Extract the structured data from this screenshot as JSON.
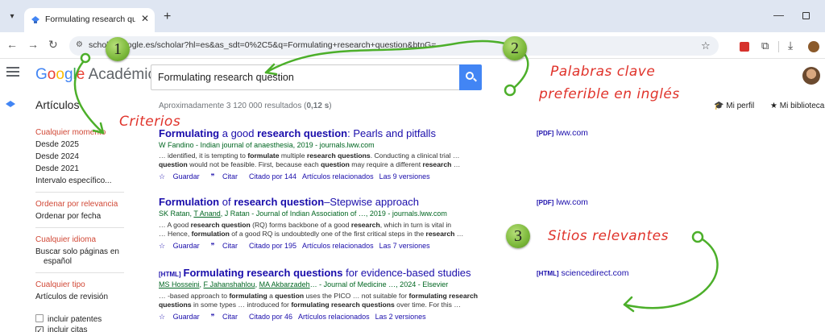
{
  "browser": {
    "tab_title": "Formulating research question",
    "url": "https://scholar.google.es/scholar?hl=es&as_sdt=0%2C5&q=Formulating+research+question&btnG=",
    "url_display": "scholar.google.es/scholar?hl=es&as_sdt=0%2C5&q=Formulating+research+question&btnG="
  },
  "header": {
    "logo_google": "Google",
    "logo_academico": "Académico",
    "search_value": "Formulating research question",
    "articles_label": "Artículos",
    "result_count_prefix": "Aproximadamente 3 120 000 resultados (",
    "result_time": "0,12 s",
    "result_count_suffix": ")",
    "my_profile": "Mi perfil",
    "my_library": "Mi biblioteca"
  },
  "sidebar": {
    "time": [
      "Cualquier momento",
      "Desde 2025",
      "Desde 2024",
      "Desde 2021",
      "Intervalo específico..."
    ],
    "sort": [
      "Ordenar por relevancia",
      "Ordenar por fecha"
    ],
    "lang": [
      "Cualquier idioma",
      "Buscar solo páginas en",
      "español"
    ],
    "type": [
      "Cualquier tipo",
      "Artículos de revisión"
    ],
    "checks": [
      "incluir patentes",
      "incluir citas"
    ]
  },
  "results": [
    {
      "tag": "",
      "title_parts": [
        "Formulating",
        " a good ",
        "research question",
        ": Pearls and pitfalls"
      ],
      "meta": "W Fandino - Indian journal of anaesthesia, 2019 - journals.lww.com",
      "snippet1": "… identified, it is tempting to formulate multiple research questions. Conducting a clinical trial …",
      "snippet2": "question would not be feasible. First, because each question may require a different research …",
      "cite_count": "Citado por 144",
      "versions": "Las 9 versiones",
      "side_tag": "[PDF]",
      "side_site": "lww.com"
    },
    {
      "tag": "",
      "title_parts": [
        "Formulation",
        " of ",
        "research question",
        "–Stepwise approach"
      ],
      "meta": "SK Ratan, T Anand, J Ratan - Journal of Indian Association of …, 2019 - journals.lww.com",
      "snippet1": "… A good research question (RQ) forms backbone of a good research, which in turn is vital in",
      "snippet2": "… Hence, formulation of a good RQ is undoubtedly one of the first critical steps in the research …",
      "cite_count": "Citado por 195",
      "versions": "Las 7 versiones",
      "side_tag": "[PDF]",
      "side_site": "lww.com"
    },
    {
      "tag": "[HTML]",
      "title_parts": [
        "Formulating research questions",
        " for evidence-based studies",
        "",
        ""
      ],
      "meta": "MS Hosseini, F Jahanshahlou, MA Akbarzadeh… - Journal of Medicine …, 2024 - Elsevier",
      "snippet1": "… -based approach to formulating a question uses the PICO … not suitable for formulating research",
      "snippet2": "questions in some types … introduced for formulating research questions over time. For this …",
      "cite_count": "Citado por 46",
      "versions": "Las 2 versiones",
      "side_tag": "[HTML]",
      "side_site": "sciencedirect.com"
    }
  ],
  "actions": {
    "save": "Guardar",
    "cite": "Citar",
    "related": "Artículos relacionados"
  },
  "annotations": {
    "badge1": "1",
    "badge2": "2",
    "badge3": "3",
    "note_criterios": "Criterios",
    "note_palabras1": "Palabras clave",
    "note_palabras2": "preferible en inglés",
    "note_sitios": "Sitios relevantes",
    "color": "#e0332b",
    "arrow_color": "#4caf2a"
  }
}
